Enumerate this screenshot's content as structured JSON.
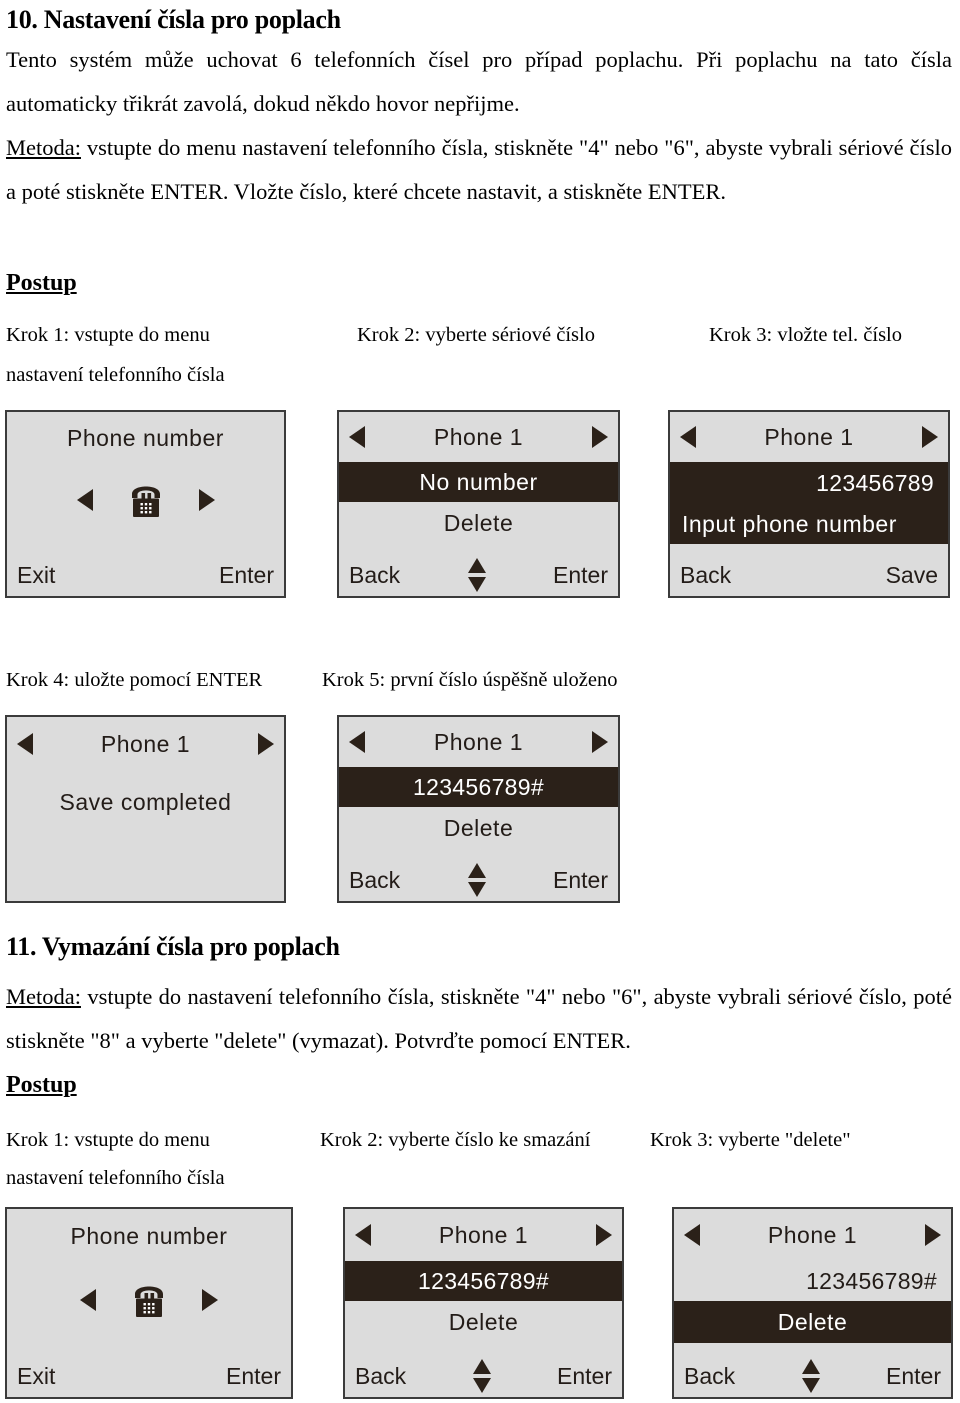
{
  "section10": {
    "heading": "10. Nastavení čísla pro poplach",
    "intro": "Tento systém může uchovat 6 telefonních čísel pro případ poplachu. Při poplachu na tato čísla automaticky třikrát zavolá, dokud někdo hovor nepřijme.",
    "method_label": "Metoda:",
    "method_text": " vstupte do menu nastavení telefonního čísla, stiskněte \"4\" nebo \"6\", abyste vybrali sériové číslo a poté stiskněte ENTER. Vložte číslo, které chcete nastavit, a stiskněte ENTER.",
    "procedure_label": "Postup",
    "steps": {
      "step1": "Krok 1: vstupte do menu",
      "step1_line2": "nastavení telefonního čísla",
      "step2": "Krok 2: vyberte sériové číslo",
      "step3": "Krok 3: vložte tel. číslo",
      "step4": "Krok 4: uložte pomocí ENTER",
      "step5": "Krok 5: první číslo úspěšně uloženo"
    }
  },
  "section11": {
    "heading": "11. Vymazání čísla pro poplach",
    "method_label": "Metoda:",
    "method_text": " vstupte do nastavení telefonního čísla, stiskněte \"4\" nebo \"6\", abyste vybrali sériové číslo, poté stiskněte \"8\" a vyberte \"delete\" (vymazat). Potvrďte pomocí ENTER.",
    "procedure_label": "Postup",
    "steps": {
      "step1": "Krok 1: vstupte do menu",
      "step1_line2": "nastavení telefonního čísla",
      "step2": "Krok 2: vyberte číslo ke smazání",
      "step3": "Krok 3: vyberte \"delete\""
    }
  },
  "screens": {
    "s1": {
      "title": "Phone number",
      "icon": "desk-phone-icon",
      "left_arrow": "left-arrow-icon",
      "right_arrow": "right-arrow-icon",
      "softkey_left": "Exit",
      "softkey_right": "Enter"
    },
    "s2": {
      "title": "Phone 1",
      "row_highlighted": "No  number",
      "row_normal": "Delete",
      "softkey_left": "Back",
      "softkey_right": "Enter",
      "scroll_icon": "up-down-arrow-icon"
    },
    "s3": {
      "title": "Phone 1",
      "number": "123456789",
      "prompt": "Input  phone  number",
      "softkey_left": "Back",
      "softkey_right": "Save"
    },
    "s4": {
      "title": "Phone 1",
      "message": "Save  completed"
    },
    "s5": {
      "title": "Phone 1",
      "row_highlighted": "123456789#",
      "row_normal": "Delete",
      "softkey_left": "Back",
      "softkey_right": "Enter",
      "scroll_icon": "up-down-arrow-icon"
    },
    "s6": {
      "title": "Phone number",
      "icon": "desk-phone-icon",
      "softkey_left": "Exit",
      "softkey_right": "Enter"
    },
    "s7": {
      "title": "Phone 1",
      "row_highlighted": "123456789#",
      "row_normal": "Delete",
      "softkey_left": "Back",
      "softkey_right": "Enter",
      "scroll_icon": "up-down-arrow-icon"
    },
    "s8": {
      "title": "Phone 1",
      "row_normal": "123456789#",
      "row_highlighted": "Delete",
      "softkey_left": "Back",
      "softkey_right": "Enter",
      "scroll_icon": "up-down-arrow-icon"
    }
  },
  "colors": {
    "lcd_background": "#dcdcdc",
    "lcd_border": "#3b3b3b",
    "lcd_ink": "#231c18",
    "lcd_inverted_bg": "#2b2119",
    "lcd_inverted_text": "#ffffff"
  }
}
